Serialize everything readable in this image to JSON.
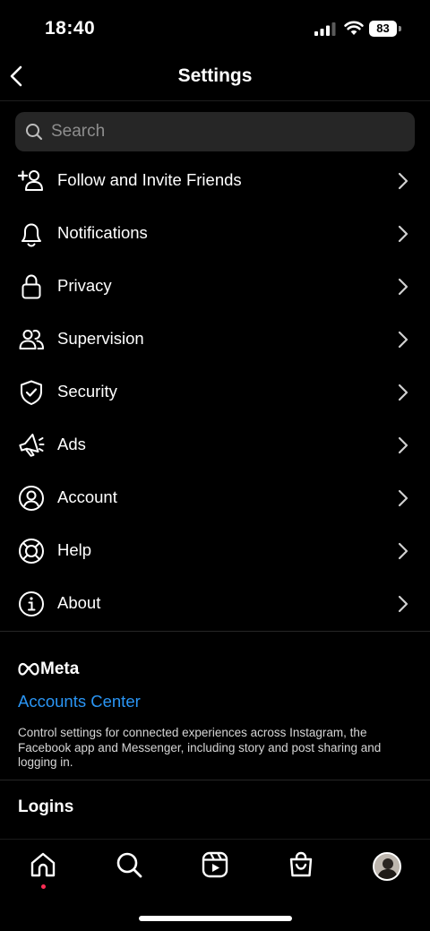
{
  "status_bar": {
    "time": "18:40",
    "battery": "83"
  },
  "header": {
    "title": "Settings"
  },
  "search": {
    "placeholder": "Search"
  },
  "menu": [
    {
      "label": "Follow and Invite Friends",
      "icon": "add-person-icon"
    },
    {
      "label": "Notifications",
      "icon": "bell-icon"
    },
    {
      "label": "Privacy",
      "icon": "lock-icon"
    },
    {
      "label": "Supervision",
      "icon": "people-icon"
    },
    {
      "label": "Security",
      "icon": "shield-icon"
    },
    {
      "label": "Ads",
      "icon": "megaphone-icon"
    },
    {
      "label": "Account",
      "icon": "account-icon"
    },
    {
      "label": "Help",
      "icon": "lifebuoy-icon"
    },
    {
      "label": "About",
      "icon": "info-icon"
    }
  ],
  "meta": {
    "brand": "Meta",
    "accounts_center": "Accounts Center",
    "description": "Control settings for connected experiences across Instagram, the Facebook app and Messenger, including story and post sharing and logging in."
  },
  "logins": {
    "title": "Logins"
  },
  "bottom_nav": [
    "home-icon",
    "search-icon",
    "reels-icon",
    "shop-icon",
    "profile-avatar"
  ],
  "colors": {
    "background": "#000000",
    "link": "#2a95f4",
    "search_bg": "#262626",
    "notification_dot": "#ff2d55"
  }
}
